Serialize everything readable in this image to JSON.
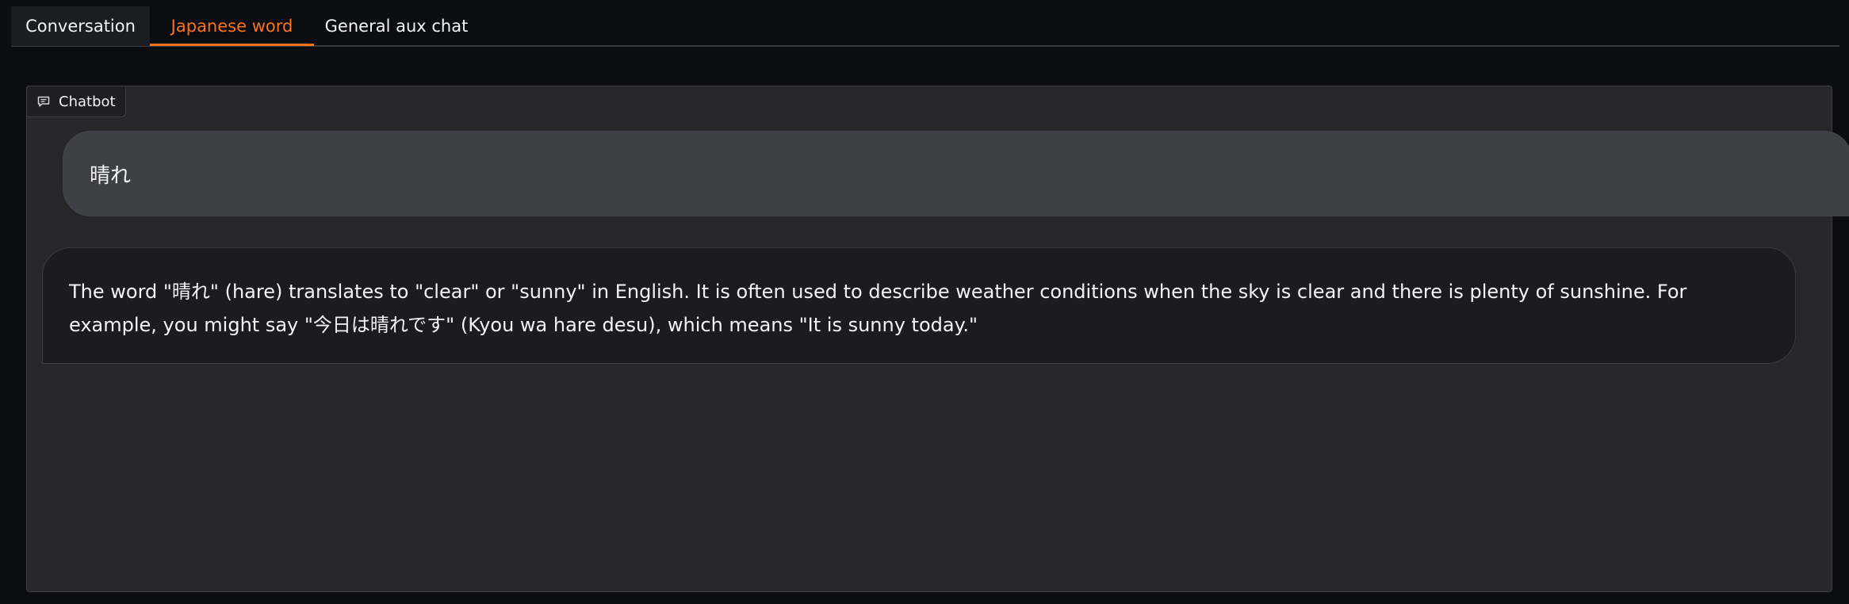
{
  "tabs": [
    {
      "label": "Conversation",
      "selected": false
    },
    {
      "label": "Japanese word",
      "selected": true
    },
    {
      "label": "General aux chat",
      "selected": false
    }
  ],
  "chatbot": {
    "label": "Chatbot",
    "icon": "chat-bubble-icon",
    "messages": [
      {
        "role": "user",
        "text": "晴れ"
      },
      {
        "role": "bot",
        "text": "The word \"晴れ\" (hare) translates to \"clear\" or \"sunny\" in English. It is often used to describe weather conditions when the sky is clear and there is plenty of sunshine. For example, you might say \"今日は晴れです\" (Kyou wa hare desu), which means \"It is sunny today.\""
      }
    ]
  },
  "colors": {
    "accent": "#f97316",
    "background": "#0c0d10",
    "panel": "#27272a",
    "user_bubble": "#3f3f46",
    "bot_bubble": "#1c1c1f"
  }
}
